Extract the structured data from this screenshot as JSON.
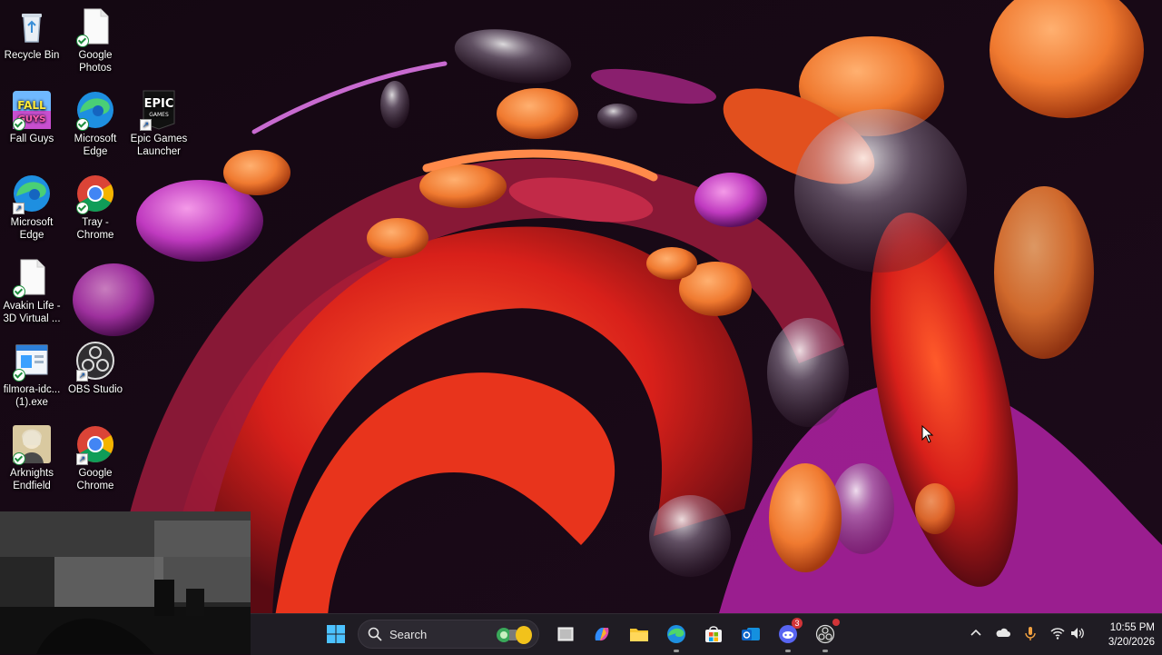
{
  "desktop": {
    "icons": [
      {
        "label": "Recycle Bin",
        "icon": "recycle-bin-icon"
      },
      {
        "label": "Google Photos",
        "icon": "document-icon"
      },
      {
        "label": "Fall Guys",
        "icon": "fall-guys-icon"
      },
      {
        "label": "Microsoft Edge",
        "icon": "edge-icon"
      },
      {
        "label": "Epic Games Launcher",
        "icon": "epic-games-icon"
      },
      {
        "label": "Microsoft Edge",
        "icon": "edge-icon"
      },
      {
        "label": "Tray - Chrome",
        "icon": "chrome-icon"
      },
      {
        "label": "Avakin Life - 3D Virtual ...",
        "icon": "document-icon"
      },
      {
        "label": "filmora-idc... (1).exe",
        "icon": "installer-icon"
      },
      {
        "label": "OBS Studio",
        "icon": "obs-icon"
      },
      {
        "label": "Arknights Endfield",
        "icon": "arknights-icon"
      },
      {
        "label": "Google Chrome",
        "icon": "chrome-icon"
      }
    ],
    "epic_logo_text": "EPIC",
    "epic_logo_sub": "GAMES"
  },
  "taskbar": {
    "search_label": "Search",
    "apps": [
      {
        "name": "start",
        "icon": "windows-start-icon"
      },
      {
        "name": "task-view",
        "icon": "task-view-icon"
      },
      {
        "name": "copilot",
        "icon": "copilot-icon"
      },
      {
        "name": "file-explorer",
        "icon": "folder-icon"
      },
      {
        "name": "edge",
        "icon": "edge-icon"
      },
      {
        "name": "store",
        "icon": "store-icon"
      },
      {
        "name": "outlook",
        "icon": "outlook-icon"
      },
      {
        "name": "discord",
        "icon": "discord-icon",
        "badge": "3"
      },
      {
        "name": "obs",
        "icon": "obs-icon"
      }
    ],
    "tray": {
      "time": "10:55 PM",
      "date": "3/20/2026"
    }
  },
  "colors": {
    "taskbar_bg": "#1f1c23",
    "accent": "#0078d4",
    "badge": "#d13438"
  }
}
